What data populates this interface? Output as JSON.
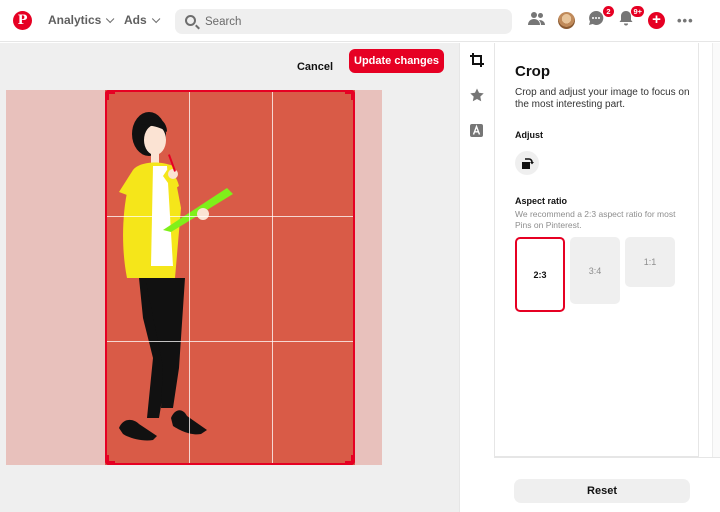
{
  "nav": {
    "logo_letter": "P",
    "analytics_label": "Analytics",
    "ads_label": "Ads",
    "search_placeholder": "Search",
    "messages_badge": "2",
    "notifications_badge": "9+",
    "plus_glyph": "+",
    "more_glyph": "•••"
  },
  "editor": {
    "cancel_label": "Cancel",
    "update_label": "Update changes",
    "crop_fill_color": "#d95b47",
    "accent_color": "#e60023"
  },
  "tools": [
    "crop-icon",
    "star-icon",
    "text-icon"
  ],
  "panel": {
    "title": "Crop",
    "description": "Crop and adjust your image to focus on the most interesting part.",
    "adjust_label": "Adjust",
    "aspect_label": "Aspect ratio",
    "aspect_description": "We recommend a 2:3 aspect ratio for most Pins on Pinterest.",
    "ratios": [
      {
        "label": "2:3",
        "selected": true
      },
      {
        "label": "3:4",
        "selected": false
      },
      {
        "label": "1:1",
        "selected": false
      }
    ],
    "reset_label": "Reset"
  }
}
